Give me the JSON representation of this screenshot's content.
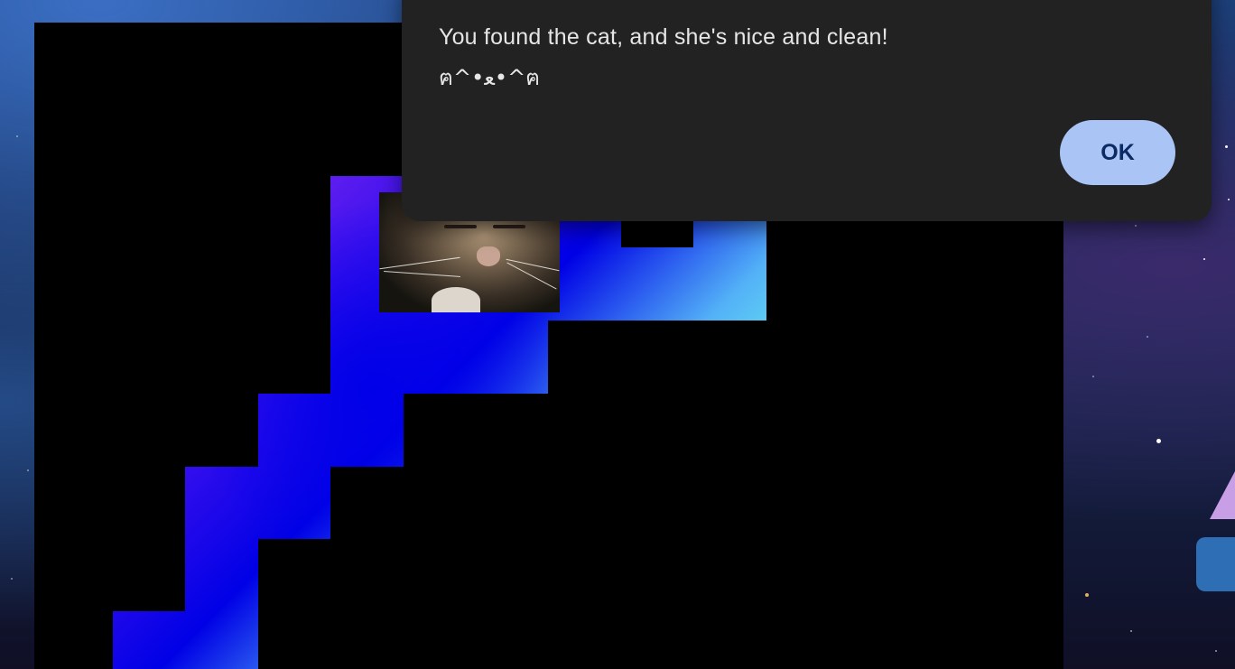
{
  "dialog": {
    "message": "You found the cat, and she's nice and clean!",
    "kaomoji": "ฅ^•ﻌ•^ฅ",
    "ok_label": "OK"
  },
  "colors": {
    "board": "#000000",
    "dialog_bg": "#222222",
    "ok_button": "#a9c4f5",
    "ok_text": "#0c2a63",
    "trail_start": "#ec2be0",
    "trail_mid": "#0000e6",
    "trail_end": "#78f06a"
  },
  "icons": {
    "cat": "cat-photo"
  }
}
